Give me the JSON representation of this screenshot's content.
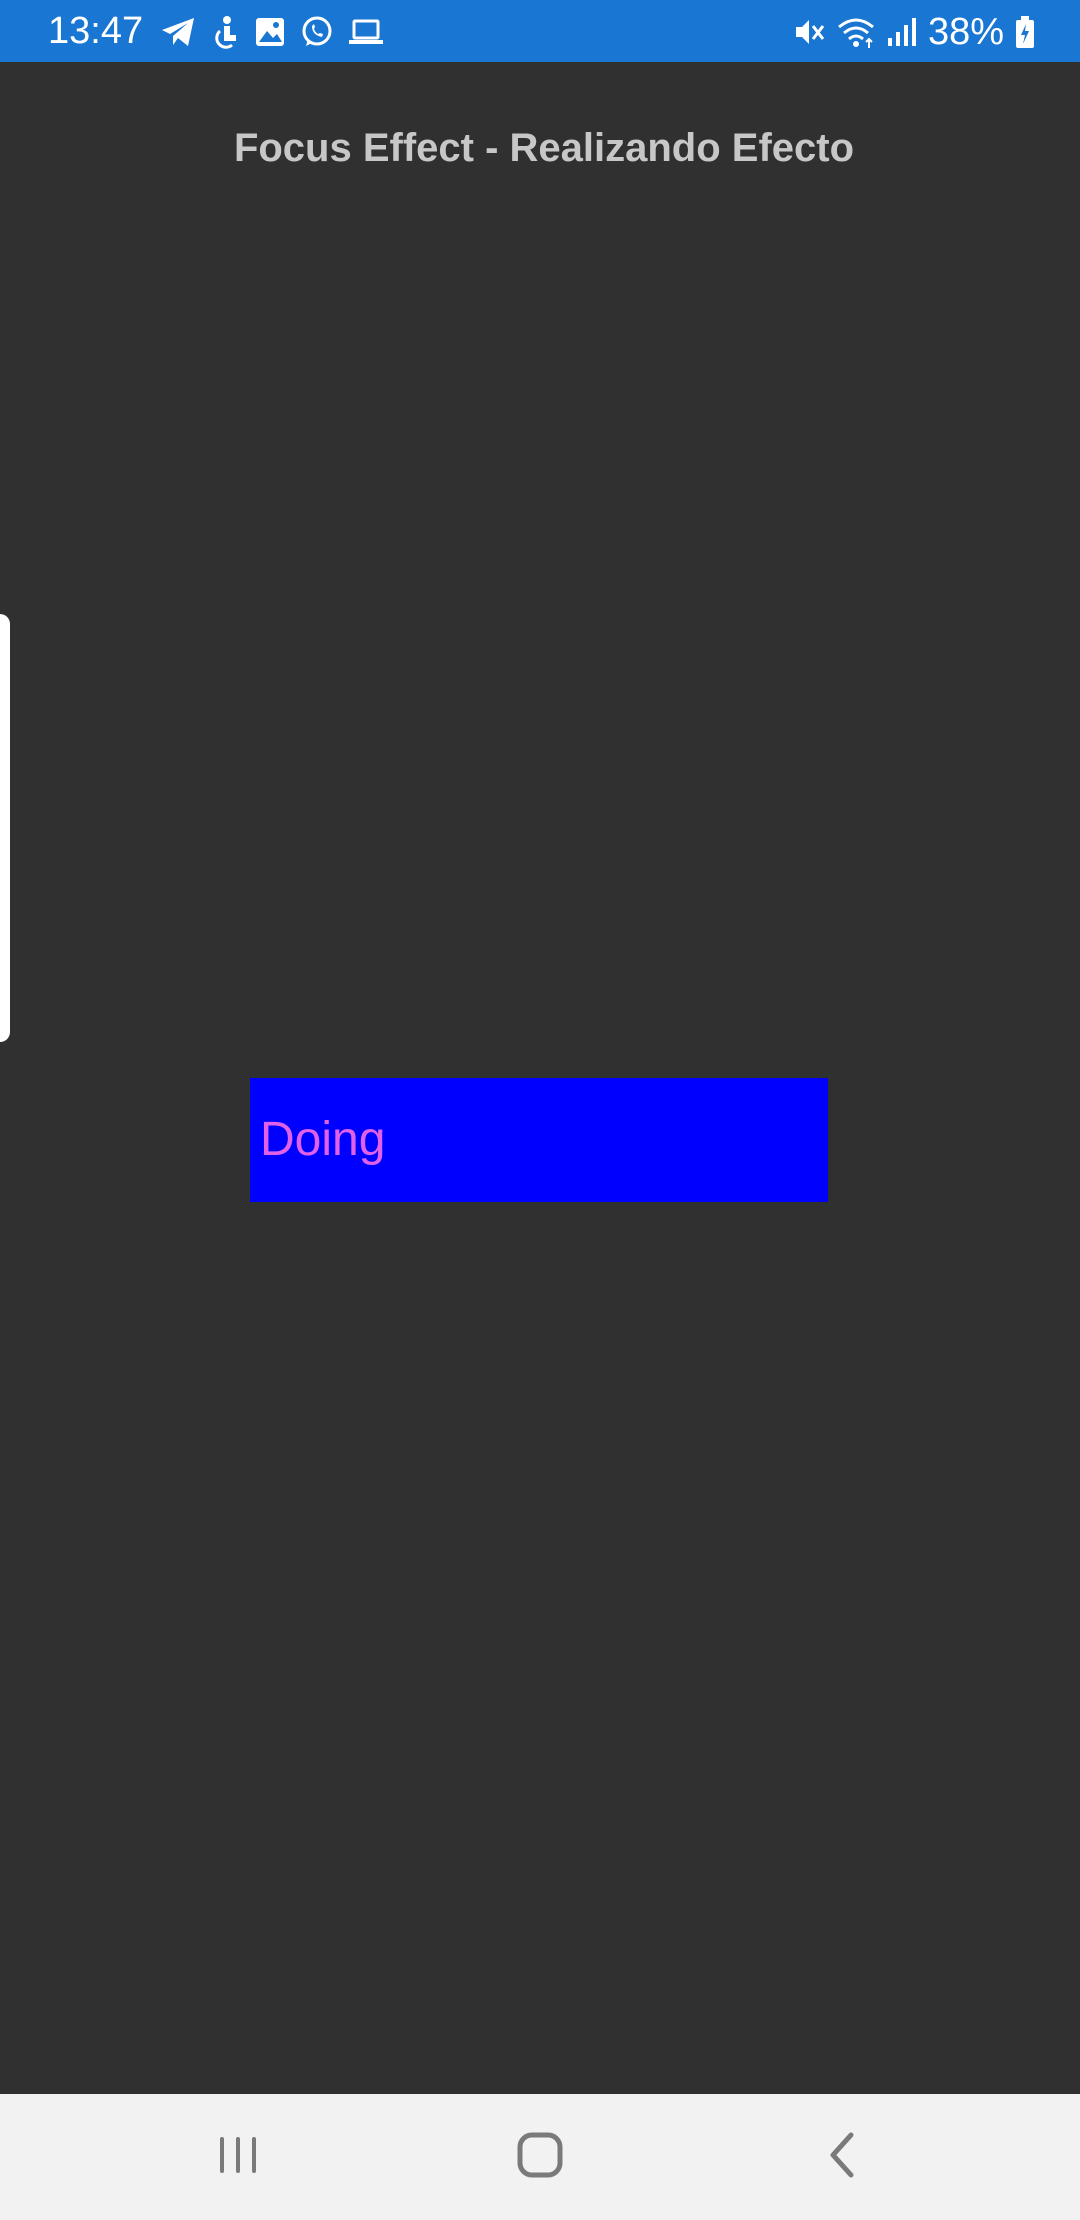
{
  "status_bar": {
    "time": "13:47",
    "left_icons": [
      "telegram-icon",
      "accessibility-icon",
      "gallery-icon",
      "whatsapp-icon",
      "laptop-icon"
    ],
    "right_icons": [
      "mute-icon",
      "wifi-icon",
      "signal-icon",
      "battery-charging-icon"
    ],
    "battery": "38%",
    "background": "#1976d2"
  },
  "page": {
    "title": "Focus Effect - Realizando Efecto",
    "background": "#303030"
  },
  "focus_box": {
    "label": "Doing",
    "background": "#0000ff",
    "text_color": "#e060e8"
  },
  "nav_bar": {
    "buttons": [
      "recents-icon",
      "home-icon",
      "back-icon"
    ],
    "background": "#f2f2f2"
  }
}
